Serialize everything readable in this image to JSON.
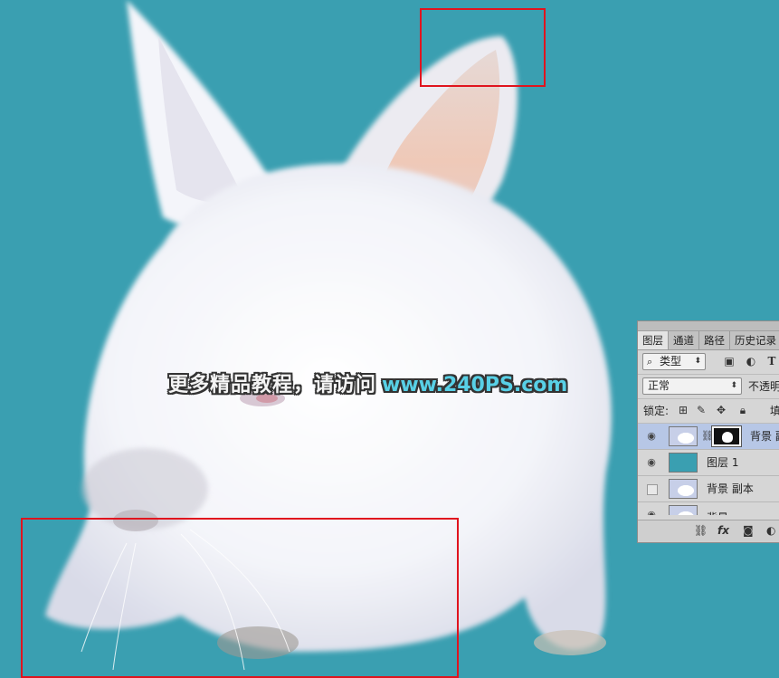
{
  "watermark": {
    "cn_text": "更多精品教程，请访问",
    "url_text": "www.240PS.com"
  },
  "colors": {
    "background": "#3a9fb1",
    "selection_box": "#e0141e",
    "selected_layer": "#b7c7e6"
  },
  "layers_panel": {
    "tabs": [
      "图层",
      "通道",
      "路径",
      "历史记录"
    ],
    "filter": {
      "label": "类型",
      "icon": "search-icon"
    },
    "filter_icons": [
      "image-filter-icon",
      "adjustment-filter-icon",
      "type-filter-icon"
    ],
    "type_icon_glyph": "T",
    "blend_mode": "正常",
    "opacity_label": "不透明",
    "lock_label": "锁定:",
    "fill_label": "填",
    "layers": [
      {
        "name": "背景 副",
        "visible": true,
        "selected": true,
        "thumb": "rabbit",
        "has_mask": true
      },
      {
        "name": "图层 1",
        "visible": true,
        "selected": false,
        "thumb": "teal",
        "has_mask": false
      },
      {
        "name": "背景 副本",
        "visible": false,
        "selected": false,
        "thumb": "rabbit",
        "has_mask": false
      },
      {
        "name": "背景",
        "visible": true,
        "selected": false,
        "thumb": "rabbit",
        "has_mask": false
      }
    ],
    "footer_icons": [
      "link-icon",
      "fx-icon",
      "mask-icon",
      "adjustment-icon"
    ],
    "footer_fx": "fx"
  }
}
